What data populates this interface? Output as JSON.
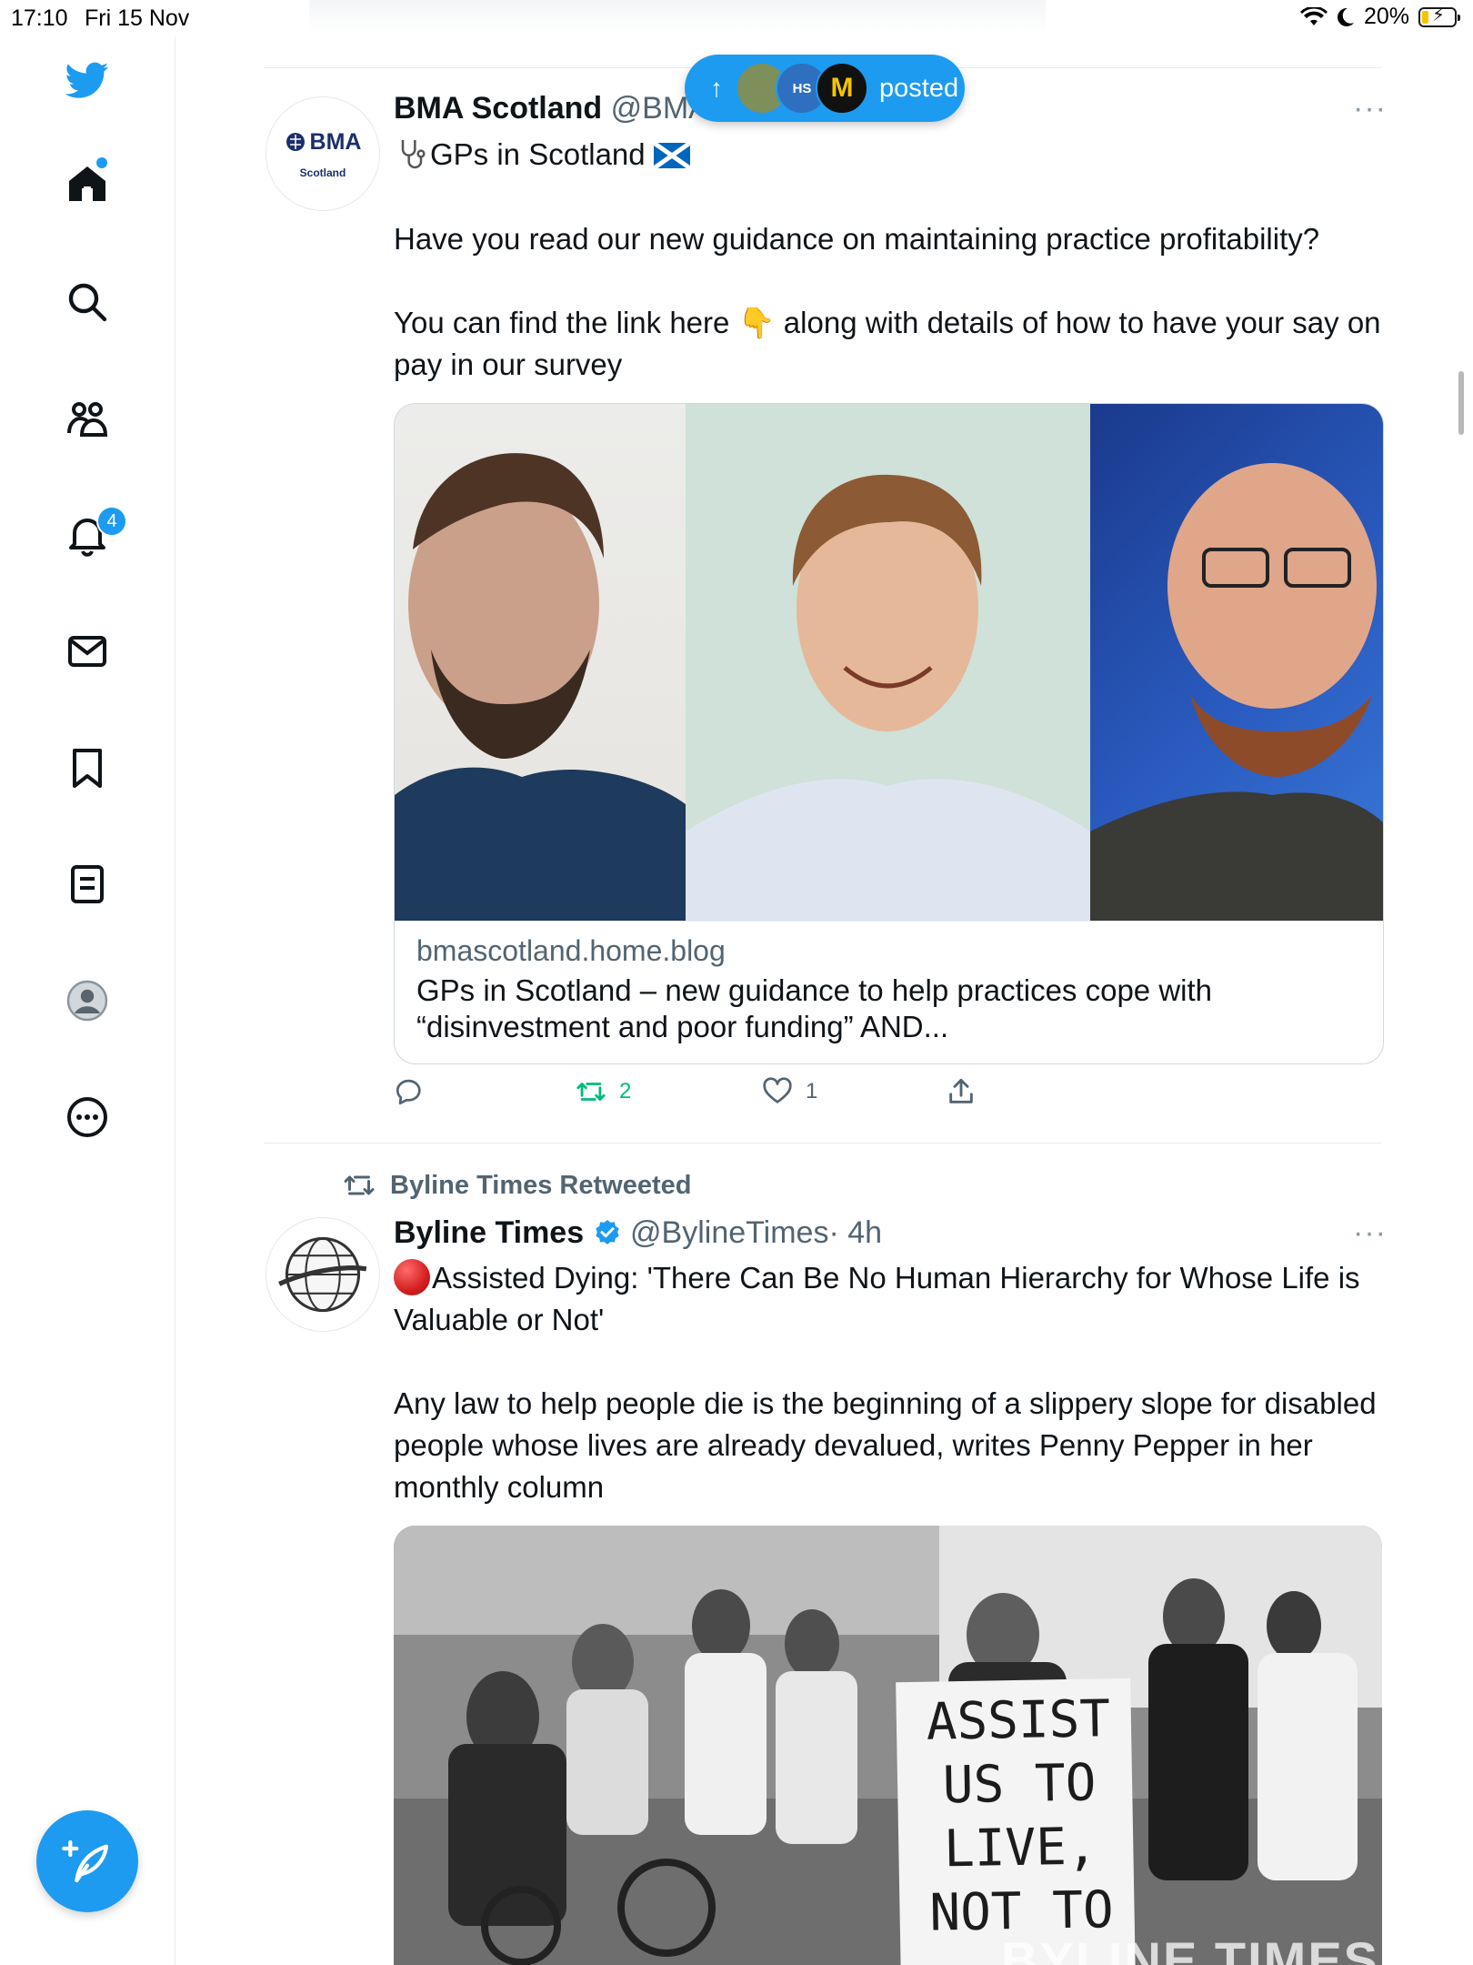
{
  "status_bar": {
    "time": "17:10",
    "date": "Fri 15 Nov",
    "battery": "20%"
  },
  "sidebar": {
    "notifications_count": "4"
  },
  "new_posts_pill": {
    "label": "posted",
    "avatar_texts": [
      "",
      "HS",
      "M"
    ]
  },
  "tweet1": {
    "name": "BMA Scotland",
    "handle": "@BMA",
    "avatar_title": "BMA",
    "avatar_subtitle": "Scotland",
    "line1": "GPs in Scotland",
    "line2": "Have you read our new guidance on maintaining practice profitability?",
    "line3": "You can find the link here 👇 along with details of how to have your say on pay in our survey",
    "card": {
      "domain": "bmascotland.home.blog",
      "title": "GPs in Scotland – new guidance to help practices cope with “disinvestment and poor funding” AND..."
    },
    "retweets": "2",
    "likes": "1"
  },
  "tweet2": {
    "retweeted_by": "Byline Times Retweeted",
    "name": "Byline Times",
    "handle": "@BylineTimes",
    "time": "· 4h",
    "line1": "Assisted Dying: 'There Can Be No Human Hierarchy for Whose Life is Valuable or Not'",
    "line2": "Any law to help people die is the beginning of a slippery slope for disabled people whose lives are already devalued, writes Penny Pepper in her monthly column",
    "sign_text": "ASSIST US TO LIVE, NOT TO",
    "watermark": "BYLINE TIMES"
  },
  "colors": {
    "accent": "#1d9bf0",
    "retweet_green": "#00ba7c",
    "secondary_text": "#536471"
  }
}
